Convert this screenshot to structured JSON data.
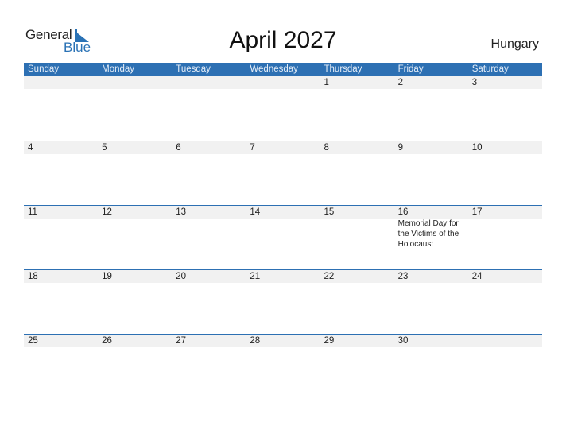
{
  "logo": {
    "text_general": "General",
    "text_blue": "Blue",
    "brand_color": "#2a72b5",
    "icon": "triangle-flag-icon"
  },
  "header": {
    "title": "April 2027",
    "country": "Hungary"
  },
  "colors": {
    "header_bg": "#2d70b3",
    "date_strip_bg": "#f1f1f1"
  },
  "weekdays": [
    "Sunday",
    "Monday",
    "Tuesday",
    "Wednesday",
    "Thursday",
    "Friday",
    "Saturday"
  ],
  "weeks": [
    {
      "days": [
        {
          "date": ""
        },
        {
          "date": ""
        },
        {
          "date": ""
        },
        {
          "date": ""
        },
        {
          "date": "1"
        },
        {
          "date": "2"
        },
        {
          "date": "3"
        }
      ]
    },
    {
      "days": [
        {
          "date": "4"
        },
        {
          "date": "5"
        },
        {
          "date": "6"
        },
        {
          "date": "7"
        },
        {
          "date": "8"
        },
        {
          "date": "9"
        },
        {
          "date": "10"
        }
      ]
    },
    {
      "days": [
        {
          "date": "11"
        },
        {
          "date": "12"
        },
        {
          "date": "13"
        },
        {
          "date": "14"
        },
        {
          "date": "15"
        },
        {
          "date": "16",
          "event": "Memorial Day for the Victims of the Holocaust"
        },
        {
          "date": "17"
        }
      ]
    },
    {
      "days": [
        {
          "date": "18"
        },
        {
          "date": "19"
        },
        {
          "date": "20"
        },
        {
          "date": "21"
        },
        {
          "date": "22"
        },
        {
          "date": "23"
        },
        {
          "date": "24"
        }
      ]
    },
    {
      "days": [
        {
          "date": "25"
        },
        {
          "date": "26"
        },
        {
          "date": "27"
        },
        {
          "date": "28"
        },
        {
          "date": "29"
        },
        {
          "date": "30"
        },
        {
          "date": ""
        }
      ]
    }
  ]
}
